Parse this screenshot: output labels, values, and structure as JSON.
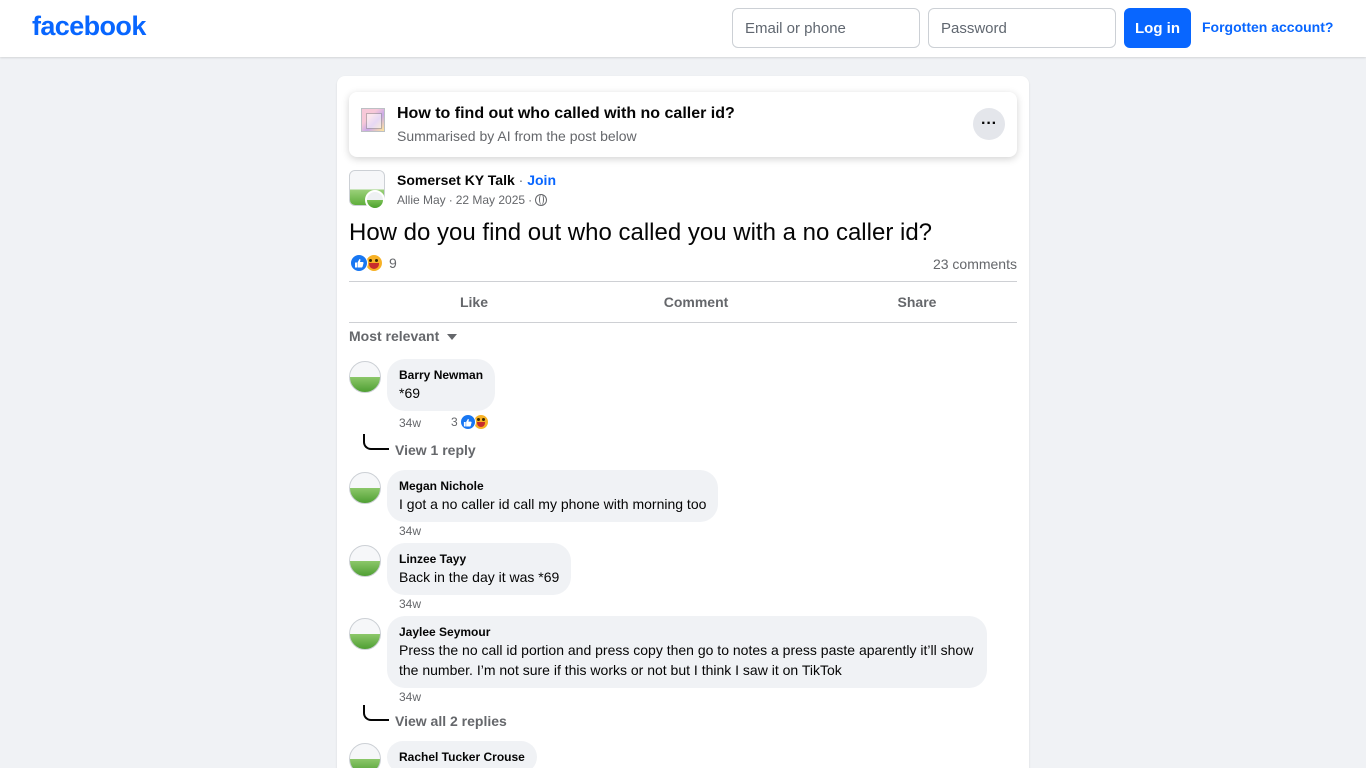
{
  "header": {
    "logo": "facebook",
    "email_placeholder": "Email or phone",
    "password_placeholder": "Password",
    "login_label": "Log in",
    "forgot_label": "Forgotten account?"
  },
  "ai_summary": {
    "title": "How to find out who called with no caller id?",
    "subtitle": "Summarised by AI from the post below",
    "more_label": "···"
  },
  "post": {
    "group_name": "Somerset KY Talk",
    "separator": " · ",
    "join_label": "Join",
    "author": "Allie May",
    "date": "22 May 2025",
    "text": "How do you find out who called you with a no caller id?",
    "reaction_count": "9",
    "comments_count": "23 comments"
  },
  "actions": {
    "like": "Like",
    "comment": "Comment",
    "share": "Share"
  },
  "sort_label": "Most relevant",
  "comments": [
    {
      "name": "Barry Newman",
      "text": "*69",
      "time": "34w",
      "reactions": "3",
      "replies_label": "View 1 reply"
    },
    {
      "name": "Megan Nichole",
      "text": "I got a no caller id call my phone with morning too",
      "time": "34w"
    },
    {
      "name": "Linzee Tayy",
      "text": "Back in the day it was *69",
      "time": "34w"
    },
    {
      "name": "Jaylee Seymour",
      "text": "Press the no call id portion and press copy then go to notes a press paste aparently it’ll show the number. I’m not sure if this works or not but I think I saw it on TikTok",
      "time": "34w",
      "replies_label": "View all 2 replies"
    },
    {
      "name": "Rachel Tucker Crouse"
    }
  ],
  "colors": {
    "brand": "#0866ff",
    "background": "#f0f2f5",
    "secondary_text": "#65676b"
  }
}
